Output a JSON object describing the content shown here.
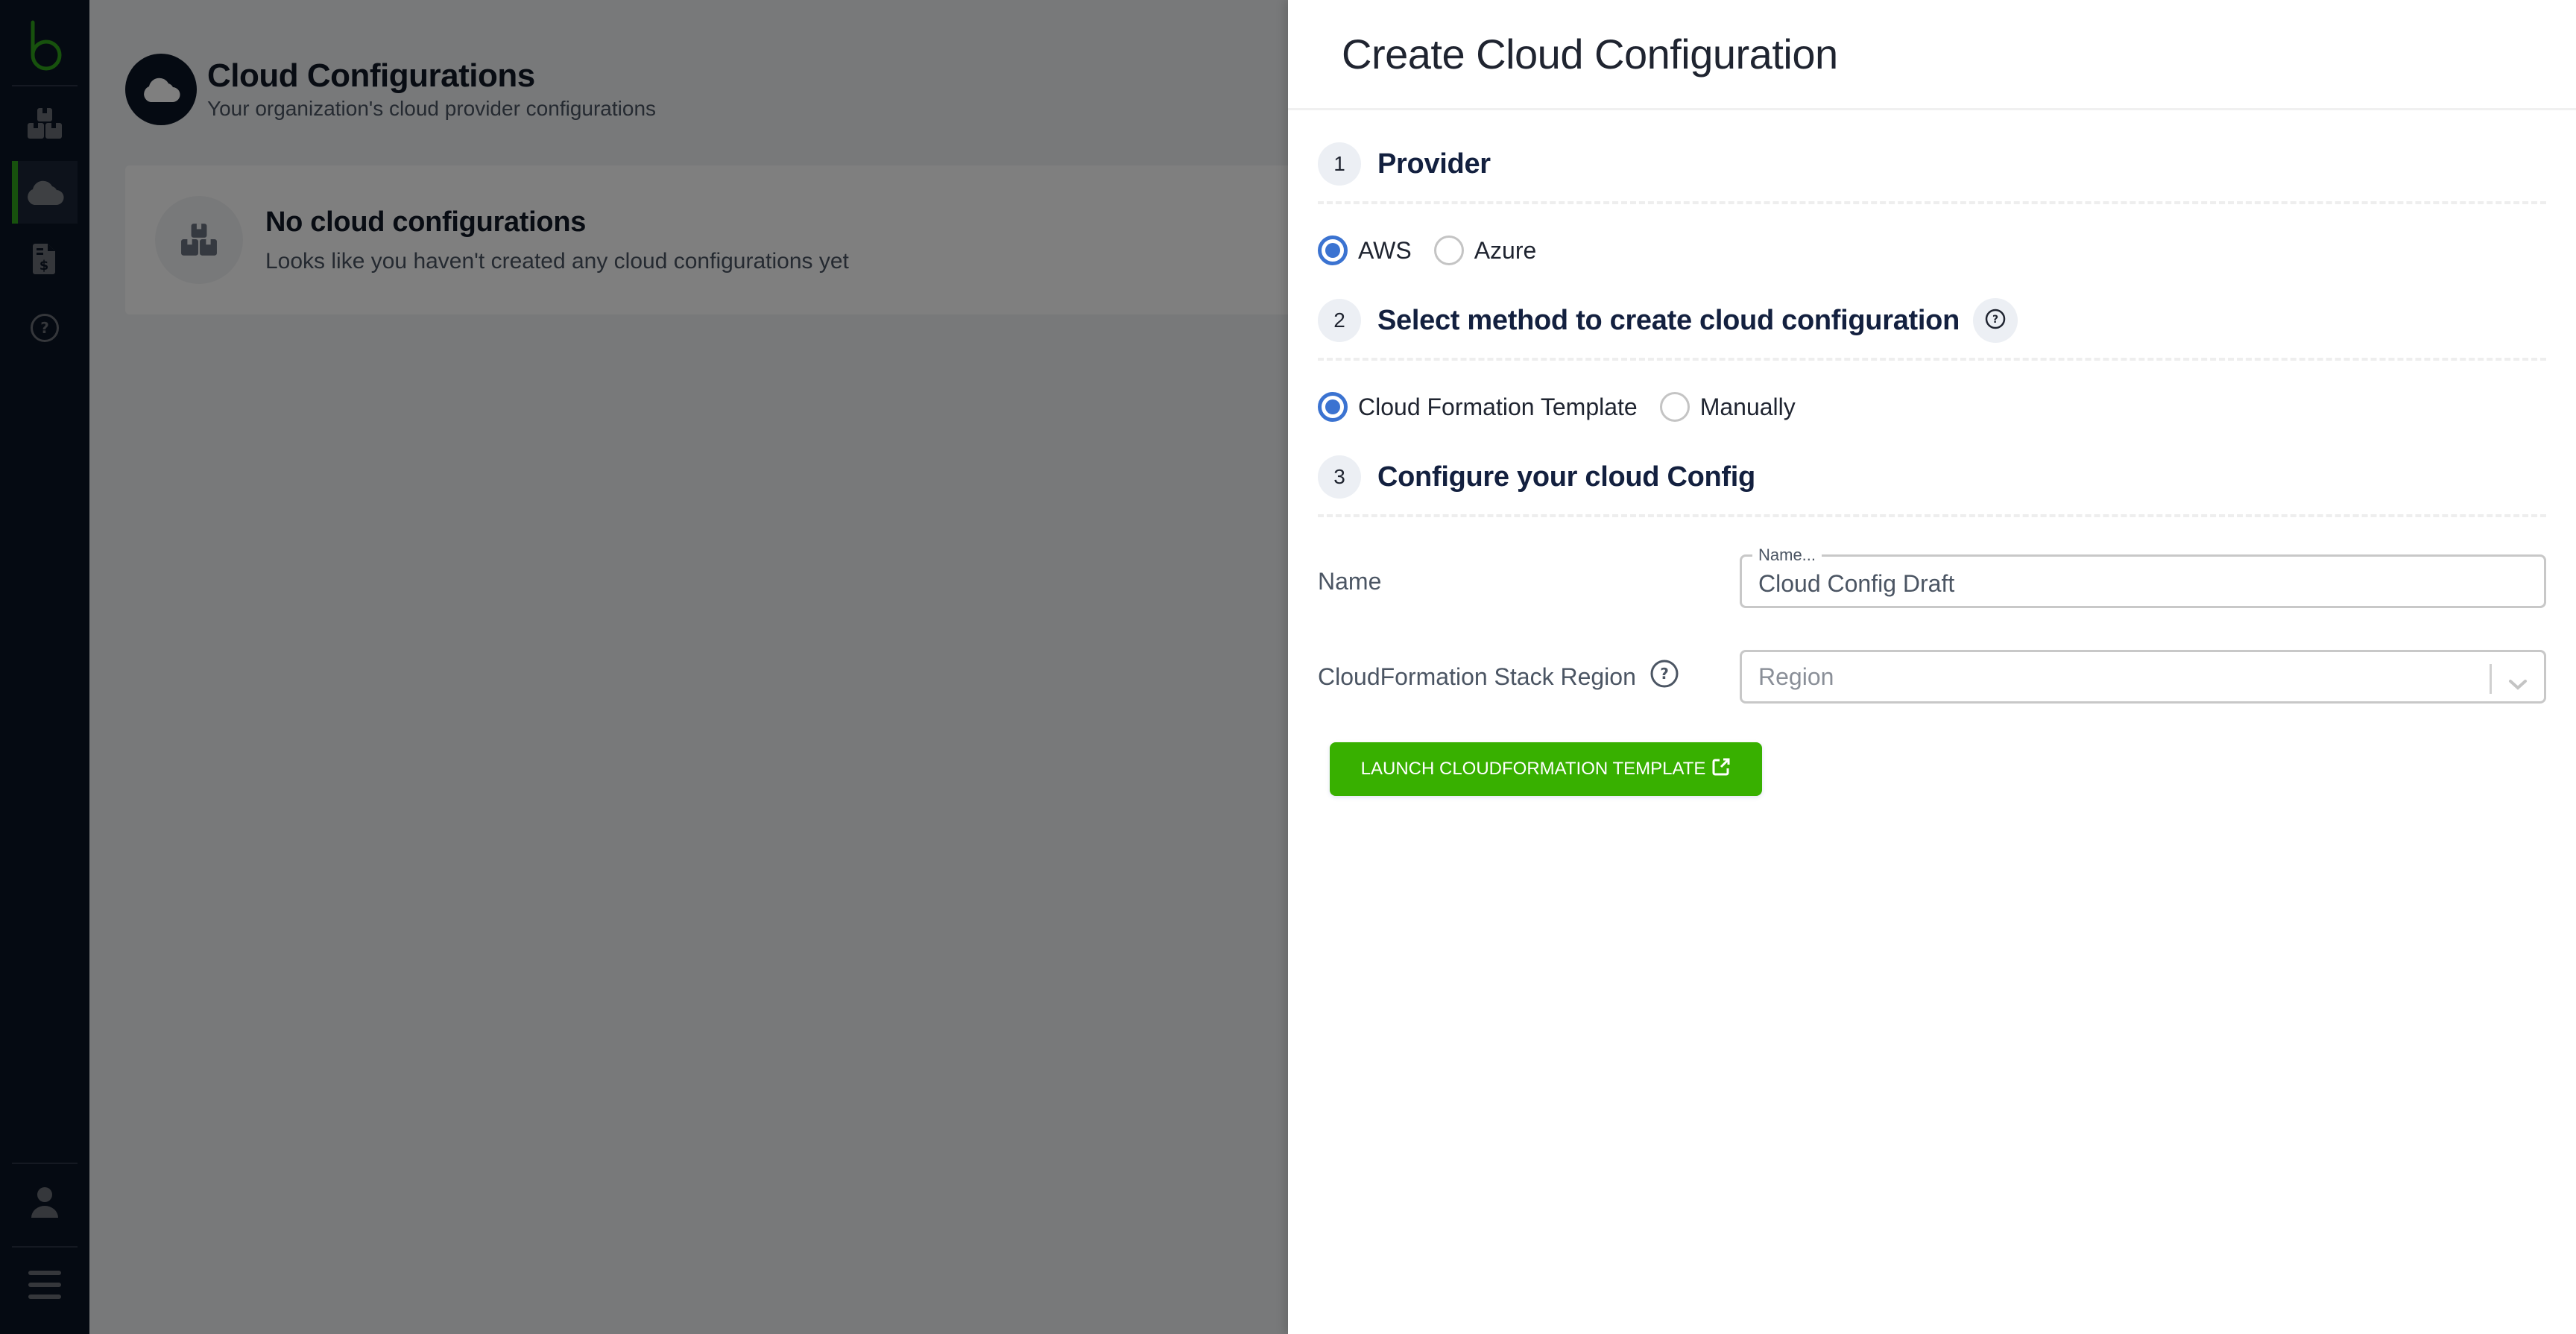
{
  "sidebar": {
    "logo": "b-logo",
    "items": [
      {
        "name": "packages",
        "icon": "boxes-icon",
        "active": false
      },
      {
        "name": "cloud-configurations",
        "icon": "cloud-icon",
        "active": true
      },
      {
        "name": "billing",
        "icon": "invoice-dollar-icon",
        "active": false
      },
      {
        "name": "help",
        "icon": "help-circle-icon",
        "active": false
      }
    ],
    "bottom_items": [
      {
        "name": "profile",
        "icon": "user-icon"
      },
      {
        "name": "menu",
        "icon": "hamburger-menu-icon"
      }
    ],
    "accent_color": "#2fa21a"
  },
  "page": {
    "title": "Cloud Configurations",
    "subtitle": "Your organization's cloud provider configurations",
    "empty_state": {
      "title": "No cloud configurations",
      "message": "Looks like you haven't created any cloud configurations yet"
    }
  },
  "drawer": {
    "title": "Create Cloud Configuration",
    "steps": [
      {
        "number": "1",
        "title": "Provider",
        "options": [
          {
            "label": "AWS",
            "checked": true
          },
          {
            "label": "Azure",
            "checked": false
          }
        ]
      },
      {
        "number": "2",
        "title": "Select method to create cloud configuration",
        "has_help": true,
        "options": [
          {
            "label": "Cloud Formation Template",
            "checked": true
          },
          {
            "label": "Manually",
            "checked": false
          }
        ]
      },
      {
        "number": "3",
        "title": "Configure your cloud Config"
      }
    ],
    "form": {
      "name_label": "Name",
      "name_field_label": "Name...",
      "name_value": "Cloud Config Draft",
      "region_label": "CloudFormation Stack Region",
      "region_placeholder": "Region",
      "region_value": ""
    },
    "launch_button": "LAUNCH CLOUDFORMATION TEMPLATE",
    "colors": {
      "radio_checked": "#3b73d1",
      "launch_button": "#38b000",
      "step_title": "#13203f"
    }
  }
}
